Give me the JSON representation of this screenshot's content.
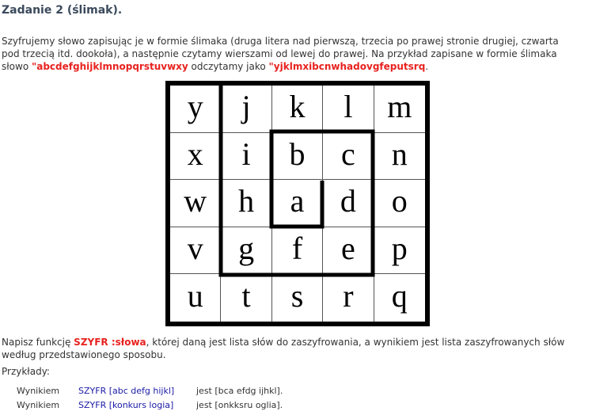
{
  "title": "Zadanie 2 (ślimak).",
  "intro": {
    "text1": "Szyfrujemy słowo zapisując je w formie ślimaka (druga litera nad pierwszą, trzecia po prawej stronie drugiej, czwarta",
    "text2": "pod trzecią itd. dookoła), a następnie czytamy wierszami od lewej do prawej. Na przykład zapisane w formie ślimaka",
    "text3a": "słowo ",
    "word": "\"abcdefghijklmnopqrstuvwxy",
    "text3b": " odczytamy jako ",
    "encoded": "\"yjklmxibcnwhadovgfeputsrq",
    "text3c": "."
  },
  "grid": {
    "rows": [
      [
        "y",
        "j",
        "k",
        "l",
        "m"
      ],
      [
        "x",
        "i",
        "b",
        "c",
        "n"
      ],
      [
        "w",
        "h",
        "a",
        "d",
        "o"
      ],
      [
        "v",
        "g",
        "f",
        "e",
        "p"
      ],
      [
        "u",
        "t",
        "s",
        "r",
        "q"
      ]
    ]
  },
  "task": {
    "text1": "Napisz funkcję ",
    "func": "SZYFR :słowa",
    "text2": ", której daną jest lista słów do zaszyfrowania, a wynikiem jest lista zaszyfrowanych słów",
    "text3": "według przedstawionego sposobu."
  },
  "examples_label": "Przykłady:",
  "examples": [
    {
      "prefix": "Wynikiem",
      "call": "SZYFR [abc defg hijkl]",
      "result": "jest [bca efdg ijhkl]."
    },
    {
      "prefix": "Wynikiem",
      "call": "SZYFR [konkurs logia]",
      "result": "jest [onkksru oglia]."
    }
  ]
}
